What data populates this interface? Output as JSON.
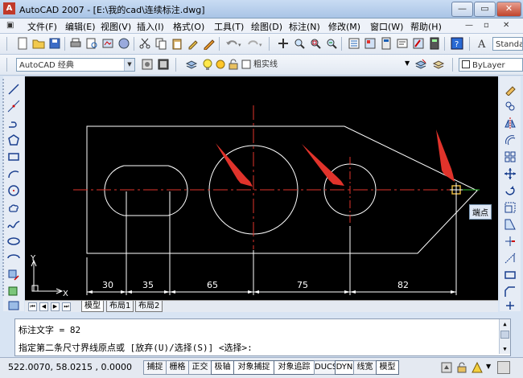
{
  "window": {
    "title": "AutoCAD 2007 - [E:\\我的cad\\连续标注.dwg]",
    "minimize_label": "—",
    "restore_label": "▭",
    "close_label": "✕"
  },
  "menu": {
    "items": [
      "文件(F)",
      "编辑(E)",
      "视图(V)",
      "插入(I)",
      "格式(O)",
      "工具(T)",
      "绘图(D)",
      "标注(N)",
      "修改(M)",
      "窗口(W)",
      "帮助(H)"
    ],
    "doc_minimize": "—",
    "doc_restore": "▫",
    "doc_close": "✕"
  },
  "toolbar": {
    "workspace": "AutoCAD 经典",
    "layer": "粗实线",
    "text_style": "Standa",
    "bylayer": "ByLayer"
  },
  "drawing": {
    "tooltip": "端点",
    "ucs_x": "X",
    "ucs_y": "Y",
    "dimensions": [
      "30",
      "35",
      "65",
      "75",
      "82"
    ]
  },
  "layout_tabs": [
    "模型",
    "布局1",
    "布局2"
  ],
  "command": {
    "line1": "标注文字 = 82",
    "line2": "指定第二条尺寸界线原点或 [放弃(U)/选择(S)] <选择>:"
  },
  "status": {
    "coords": "522.0070, 58.0215 , 0.0000",
    "toggles": [
      "捕捉",
      "栅格",
      "正交",
      "极轴",
      "对象捕捉",
      "对象追踪",
      "DUCS",
      "DYN",
      "线宽",
      "模型"
    ]
  },
  "colors": {
    "accent_red": "#e0332b",
    "drawing_line": "#ffffff",
    "center_line": "#e0332b",
    "canvas_bg": "#000000"
  }
}
